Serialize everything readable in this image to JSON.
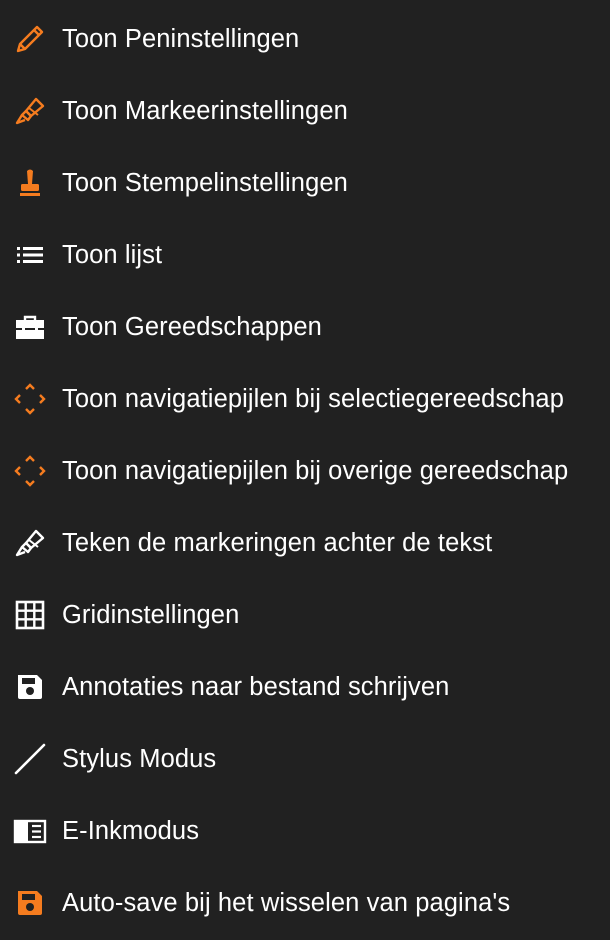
{
  "colors": {
    "background": "#212121",
    "text": "#ffffff",
    "accent": "#f57c1f",
    "icon_white": "#ffffff"
  },
  "menu": {
    "items": [
      {
        "label": "Toon Peninstellingen",
        "icon": "pencil-icon"
      },
      {
        "label": "Toon Markeerinstellingen",
        "icon": "marker-icon"
      },
      {
        "label": "Toon Stempelinstellingen",
        "icon": "stamp-icon"
      },
      {
        "label": "Toon lijst",
        "icon": "list-icon"
      },
      {
        "label": "Toon Gereedschappen",
        "icon": "toolbox-icon"
      },
      {
        "label": "Toon navigatiepijlen bij selectiegereedschap",
        "icon": "navigation-arrows-icon"
      },
      {
        "label": "Toon navigatiepijlen bij overige gereedschap",
        "icon": "navigation-arrows-icon"
      },
      {
        "label": "Teken de markeringen achter de tekst",
        "icon": "marker-icon"
      },
      {
        "label": "Gridinstellingen",
        "icon": "grid-icon"
      },
      {
        "label": "Annotaties naar bestand schrijven",
        "icon": "save-icon"
      },
      {
        "label": "Stylus Modus",
        "icon": "stylus-icon"
      },
      {
        "label": "E-Inkmodus",
        "icon": "e-ink-icon"
      },
      {
        "label": "Auto-save bij het wisselen van pagina's",
        "icon": "save-icon"
      }
    ]
  }
}
